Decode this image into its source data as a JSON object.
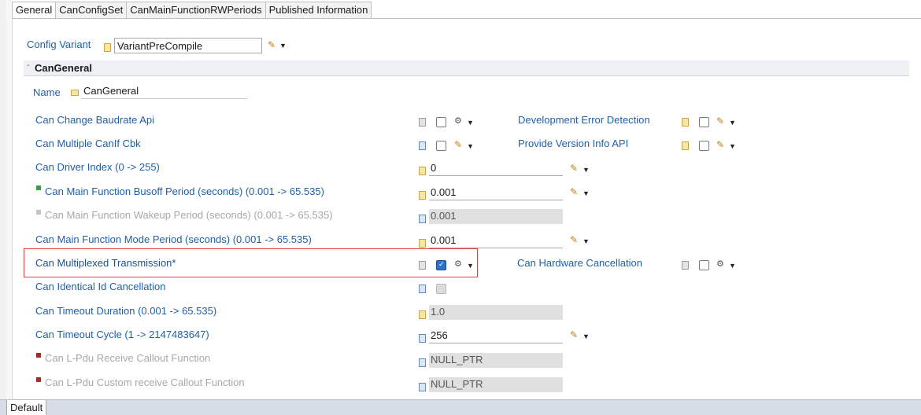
{
  "tabs": [
    "General",
    "CanConfigSet",
    "CanMainFunctionRWPeriods",
    "Published Information"
  ],
  "config_variant": {
    "label": "Config Variant",
    "value": "VariantPreCompile"
  },
  "section": {
    "title": "CanGeneral",
    "collapse_glyph": "-"
  },
  "name_row": {
    "label": "Name",
    "value": "CanGeneral"
  },
  "rows": [
    {
      "label": "Can Change Baudrate Api"
    },
    {
      "label": "Can Multiple CanIf Cbk"
    },
    {
      "label": "Can Driver Index (0 -> 255)",
      "value": "0"
    },
    {
      "label": "Can Main Function Busoff Period (seconds) (0.001 -> 65.535)",
      "value": "0.001"
    },
    {
      "label": "Can Main Function Wakeup Period (seconds) (0.001 -> 65.535)",
      "value": "0.001"
    },
    {
      "label": "Can Main Function Mode Period (seconds) (0.001 -> 65.535)",
      "value": "0.001"
    },
    {
      "label": "Can Multiplexed Transmission*"
    },
    {
      "label": "Can Identical Id Cancellation"
    },
    {
      "label": "Can Timeout Duration (0.001 -> 65.535)",
      "value": "1.0"
    },
    {
      "label": "Can Timeout Cycle (1 -> 2147483647)",
      "value": "256"
    },
    {
      "label": "Can L-Pdu Receive Callout Function",
      "value": "NULL_PTR"
    },
    {
      "label": "Can L-Pdu Custom receive Callout Function",
      "value": "NULL_PTR"
    }
  ],
  "right": {
    "dev_error": "Development Error Detection",
    "version_info": "Provide Version Info API",
    "hw_cancel": "Can Hardware Cancellation"
  },
  "icons": {
    "pencil": "✎",
    "dropdown": "▼",
    "gear": "⚙",
    "chevron": "⌵"
  },
  "colors": {
    "label": "#1f5fa8",
    "highlight": "#e0433f",
    "checked": "#2f73c7"
  },
  "status": {
    "default_tab": "Default"
  }
}
